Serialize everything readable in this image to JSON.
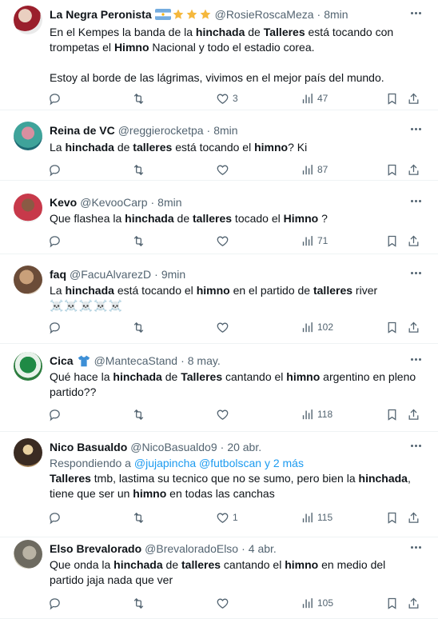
{
  "tweets": [
    {
      "name": "La Negra Peronista",
      "handle": "@RosieRoscaMeza",
      "time": "8min",
      "badges": [
        "flag-argentina-icon",
        "star-icon",
        "star-icon",
        "star-icon"
      ],
      "text": "En el Kempes la banda de la hinchada de Talleres está tocando con trompetas el Himno Nacional y todo el estadio corea.\n\nEstoy al borde de las lágrimas, vivimos en el mejor país del mundo.",
      "likes": "3",
      "views": "47"
    },
    {
      "name": "Reina de VC",
      "handle": "@reggierocketpa",
      "time": "8min",
      "text": "La hinchada de talleres está tocando el himno? Ki",
      "likes": "",
      "views": "87"
    },
    {
      "name": "Kevo",
      "handle": "@KevooCarp",
      "time": "8min",
      "text": "Que flashea la hinchada de talleres tocado el Himno ?",
      "likes": "",
      "views": "71"
    },
    {
      "name": "faq",
      "handle": "@FacuAlvarezD",
      "time": "9min",
      "text": "La hinchada está tocando el himno en el partido de talleres river",
      "skulls": "☠️☠️☠️☠️☠️",
      "likes": "",
      "views": "102"
    },
    {
      "name": "Cica",
      "handle": "@MantecaStand",
      "time": "8 may.",
      "badges": [
        "shirt-icon"
      ],
      "text": "Qué hace la hinchada de Talleres cantando el himno argentino en pleno partido??",
      "likes": "",
      "views": "118"
    },
    {
      "name": "Nico Basualdo",
      "handle": "@NicoBasualdo9",
      "time": "20 abr.",
      "reply_prefix": "Respondiendo a",
      "reply_to": "@jujapincha @futbolscan y 2 más",
      "text": "Talleres tmb, lastima su tecnico que no se sumo, pero bien la hinchada, tiene que ser un himno en todas las canchas",
      "likes": "1",
      "views": "115"
    },
    {
      "name": "Elso Brevalorado",
      "handle": "@BrevaloradoElso",
      "time": "4 abr.",
      "text": "Que onda la hinchada de talleres cantando el himno en medio del partido jaja nada que ver",
      "likes": "",
      "views": "105"
    }
  ],
  "highlight_words": [
    "hinchada",
    "Talleres",
    "talleres",
    "Himno",
    "himno"
  ],
  "colors": {
    "text": "#0f1419",
    "muted": "#536471",
    "link": "#1d9bf0",
    "divider": "#eff3f4"
  }
}
